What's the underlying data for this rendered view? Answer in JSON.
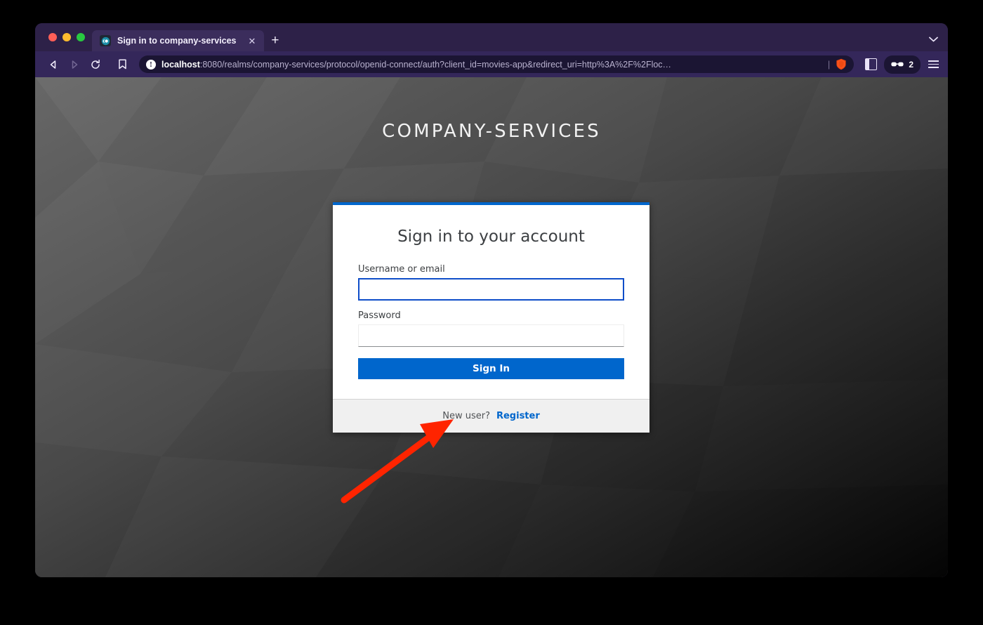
{
  "browser": {
    "window_controls": [
      "close",
      "minimize",
      "maximize"
    ],
    "tab": {
      "title": "Sign in to company-services",
      "favicon_name": "keycloak-favicon",
      "close_label": "✕"
    },
    "new_tab_label": "+",
    "toolbar": {
      "back_label": "◁",
      "forward_label": "▷",
      "reload_label": "⟳",
      "bookmark_label": "ὑ6",
      "url_host": "localhost",
      "url_rest": ":8080/realms/company-services/protocol/openid-connect/auth?client_id=movies-app&redirect_uri=http%3A%2F%2Floc…",
      "url_full": "localhost:8080/realms/company-services/protocol/openid-connect/auth?client_id=movies-app&redirect_uri=http%3A%2F%2Floc...",
      "info_icon_label": "!",
      "divider": "|",
      "shields_count": "2",
      "sidebar_toggle_name": "sidebar-panel-icon",
      "menu_name": "hamburger-menu-icon"
    }
  },
  "page": {
    "realm_title": "COMPANY-SERVICES",
    "card": {
      "heading": "Sign in to your account",
      "fields": [
        {
          "label": "Username or email",
          "value": "",
          "placeholder": "",
          "focused": true,
          "type": "text",
          "name": "username-field"
        },
        {
          "label": "Password",
          "value": "",
          "placeholder": "",
          "focused": false,
          "type": "password",
          "name": "password-field"
        }
      ],
      "submit_label": "Sign In",
      "footer_text": "New user?",
      "footer_link": "Register"
    },
    "colors": {
      "accent_blue": "#0066CC",
      "focus_blue": "#0F4EC9",
      "card_bg": "#FFFFFF",
      "footer_bg": "#F0F0F0",
      "browser_chrome": "#34275A",
      "annotation_red": "#FF2400"
    }
  },
  "annotation": {
    "arrow_name": "red-arrow-pointing-to-register",
    "color": "#FF2400",
    "points_to": "Register link"
  }
}
